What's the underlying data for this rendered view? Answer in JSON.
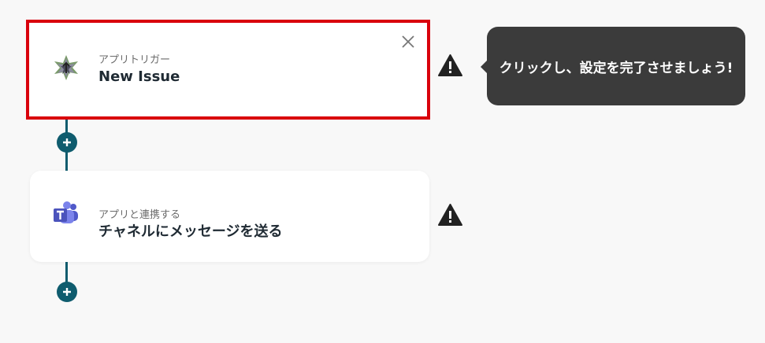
{
  "steps": [
    {
      "subtitle": "アプリトリガー",
      "title": "New Issue",
      "icon": "linear-app-icon"
    },
    {
      "subtitle": "アプリと連携する",
      "title": "チャネルにメッセージを送る",
      "icon": "microsoft-teams-icon"
    }
  ],
  "tooltip": {
    "text": "クリックし、設定を完了させましょう!"
  },
  "colors": {
    "connector": "#0f5c6e",
    "selected_border": "#d9000c",
    "tooltip_bg": "#3b3b3b",
    "teams": "#5059c9"
  }
}
